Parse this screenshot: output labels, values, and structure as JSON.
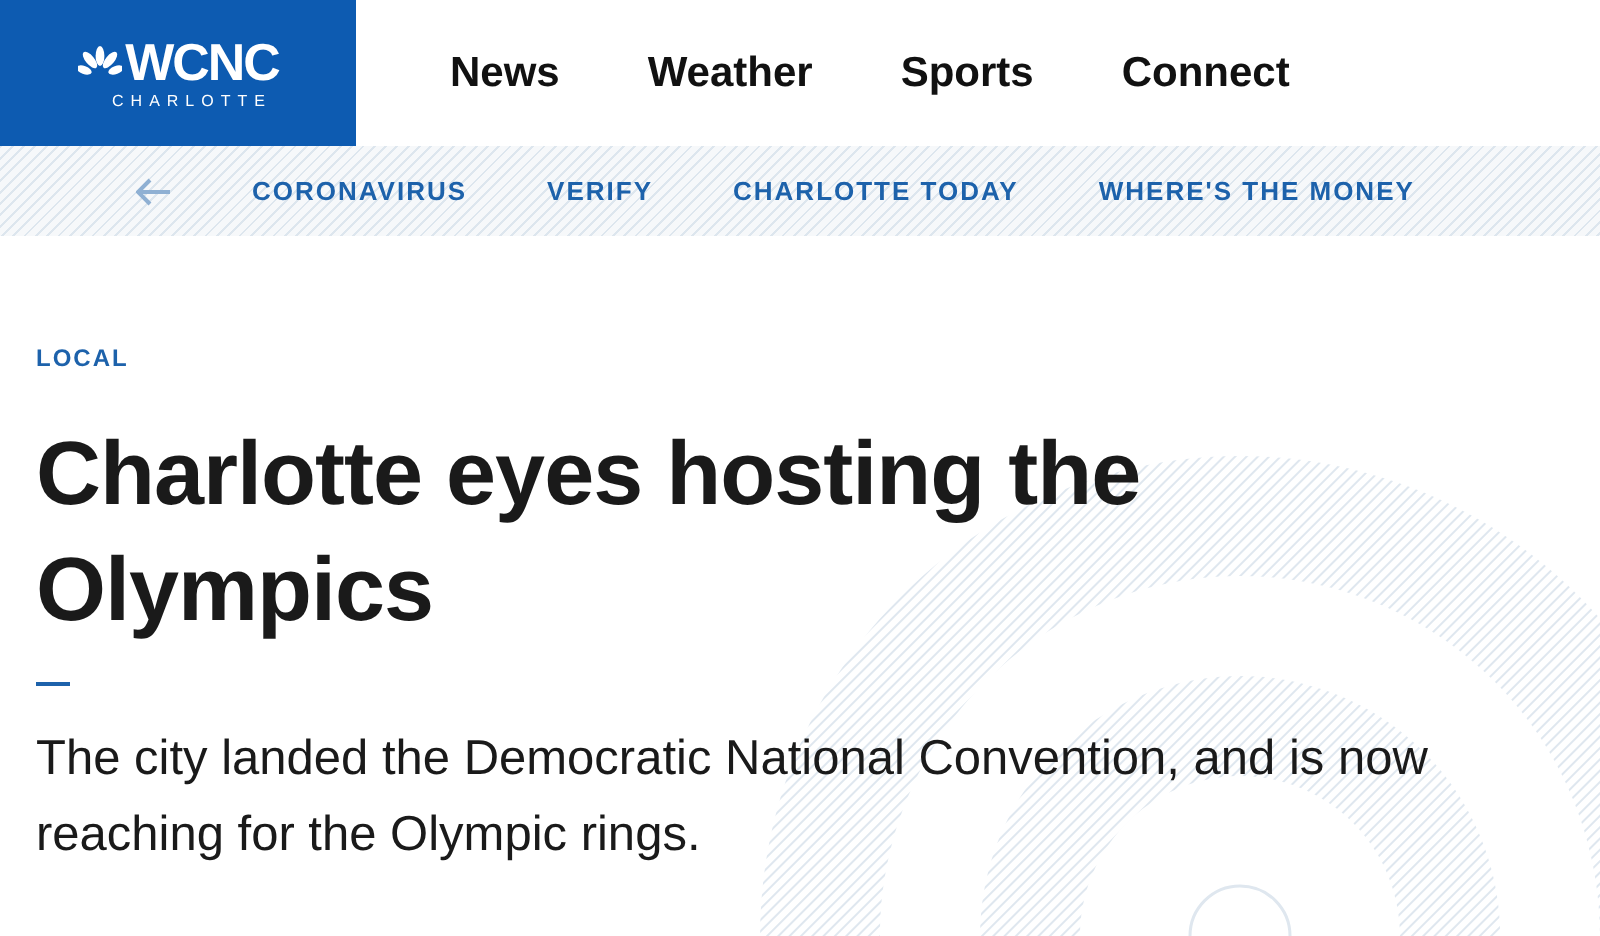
{
  "logo": {
    "name": "WCNC",
    "location": "CHARLOTTE"
  },
  "main_nav": [
    "News",
    "Weather",
    "Sports",
    "Connect"
  ],
  "sub_nav": [
    "CORONAVIRUS",
    "VERIFY",
    "CHARLOTTE TODAY",
    "WHERE'S THE MONEY"
  ],
  "article": {
    "category": "LOCAL",
    "headline": "Charlotte eyes hosting the Olympics",
    "summary": "The city landed the Democratic National Convention, and is now reaching for the Olympic rings."
  }
}
